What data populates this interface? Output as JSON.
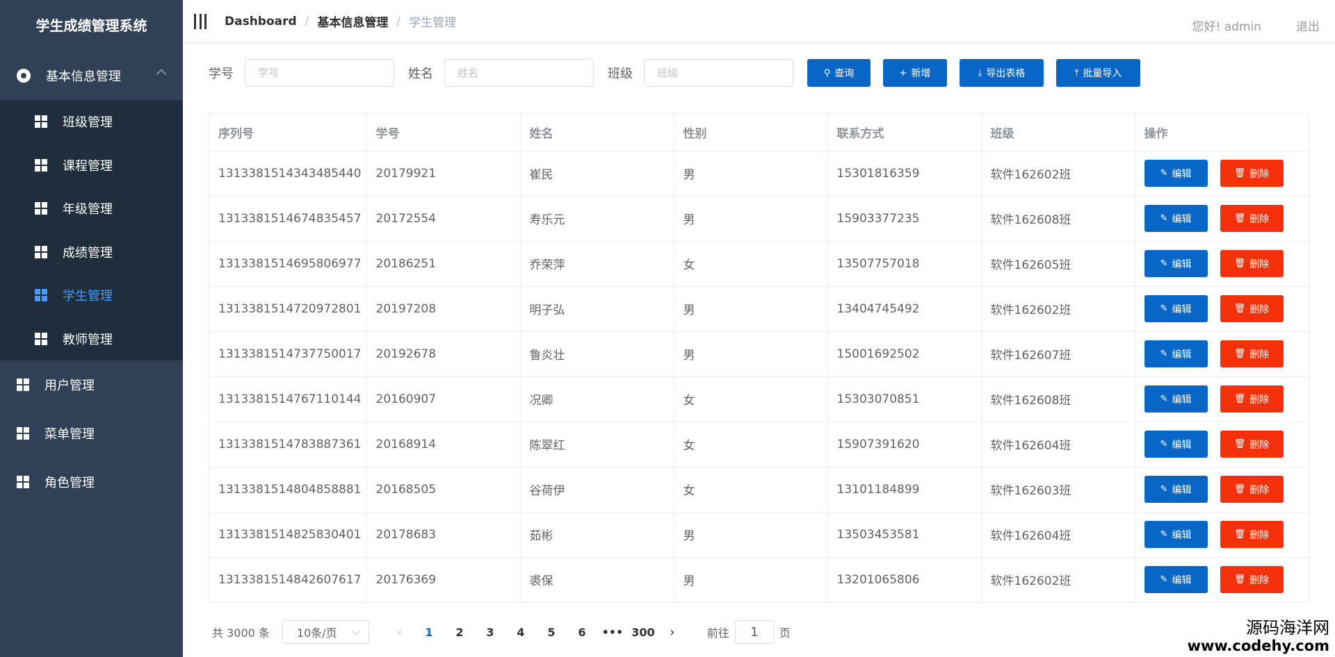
{
  "sidebar": {
    "title": "学生成绩管理系统",
    "group": {
      "label": "基本信息管理",
      "icon": "settings-icon",
      "expanded": true
    },
    "sub_items": [
      {
        "label": "班级管理",
        "active": false
      },
      {
        "label": "课程管理",
        "active": false
      },
      {
        "label": "年级管理",
        "active": false
      },
      {
        "label": "成绩管理",
        "active": false
      },
      {
        "label": "学生管理",
        "active": true
      },
      {
        "label": "教师管理",
        "active": false
      }
    ],
    "items": [
      {
        "label": "用户管理"
      },
      {
        "label": "菜单管理"
      },
      {
        "label": "角色管理"
      }
    ]
  },
  "header": {
    "breadcrumb": [
      "Dashboard",
      "基本信息管理",
      "学生管理"
    ],
    "greeting": "您好!  admin",
    "logout": "退出"
  },
  "filter": {
    "student_no": {
      "label": "学号",
      "placeholder": "学号",
      "value": ""
    },
    "name": {
      "label": "姓名",
      "placeholder": "姓名",
      "value": ""
    },
    "class": {
      "label": "班级",
      "placeholder": "班级",
      "value": ""
    },
    "buttons": {
      "search": "查询",
      "add": "新增",
      "export": "导出表格",
      "import": "批量导入"
    }
  },
  "table": {
    "columns": [
      "序列号",
      "学号",
      "姓名",
      "性别",
      "联系方式",
      "班级",
      "操作"
    ],
    "edit_label": "编辑",
    "delete_label": "删除",
    "rows": [
      [
        "1313381514343485440",
        "20179921",
        "崔民",
        "男",
        "15301816359",
        "软件162602班"
      ],
      [
        "1313381514674835457",
        "20172554",
        "寿乐元",
        "男",
        "15903377235",
        "软件162608班"
      ],
      [
        "1313381514695806977",
        "20186251",
        "乔荣萍",
        "女",
        "13507757018",
        "软件162605班"
      ],
      [
        "1313381514720972801",
        "20197208",
        "明子弘",
        "男",
        "13404745492",
        "软件162602班"
      ],
      [
        "1313381514737750017",
        "20192678",
        "鲁炎壮",
        "男",
        "15001692502",
        "软件162607班"
      ],
      [
        "1313381514767110144",
        "20160907",
        "况卿",
        "女",
        "15303070851",
        "软件162608班"
      ],
      [
        "1313381514783887361",
        "20168914",
        "陈翠红",
        "女",
        "15907391620",
        "软件162604班"
      ],
      [
        "1313381514804858881",
        "20168505",
        "谷荷伊",
        "女",
        "13101184899",
        "软件162603班"
      ],
      [
        "1313381514825830401",
        "20178683",
        "茹彬",
        "男",
        "13503453581",
        "软件162604班"
      ],
      [
        "1313381514842607617",
        "20176369",
        "裘保",
        "男",
        "13201065806",
        "软件162602班"
      ]
    ]
  },
  "pagination": {
    "total": "共 3000 条",
    "page_size": "10条/页",
    "pages": [
      "1",
      "2",
      "3",
      "4",
      "5",
      "6",
      "•••",
      "300"
    ],
    "current": "1",
    "goto_prefix": "前往",
    "goto_value": "1",
    "goto_suffix": "页"
  },
  "watermark": {
    "line1": "源码海洋网",
    "line2": "www.codehy.com"
  },
  "colors": {
    "sidebar_bg": "#304156",
    "submenu_bg": "#1f2d3d",
    "active": "#409eff",
    "primary": "#0866c6",
    "danger": "#f5310b"
  }
}
